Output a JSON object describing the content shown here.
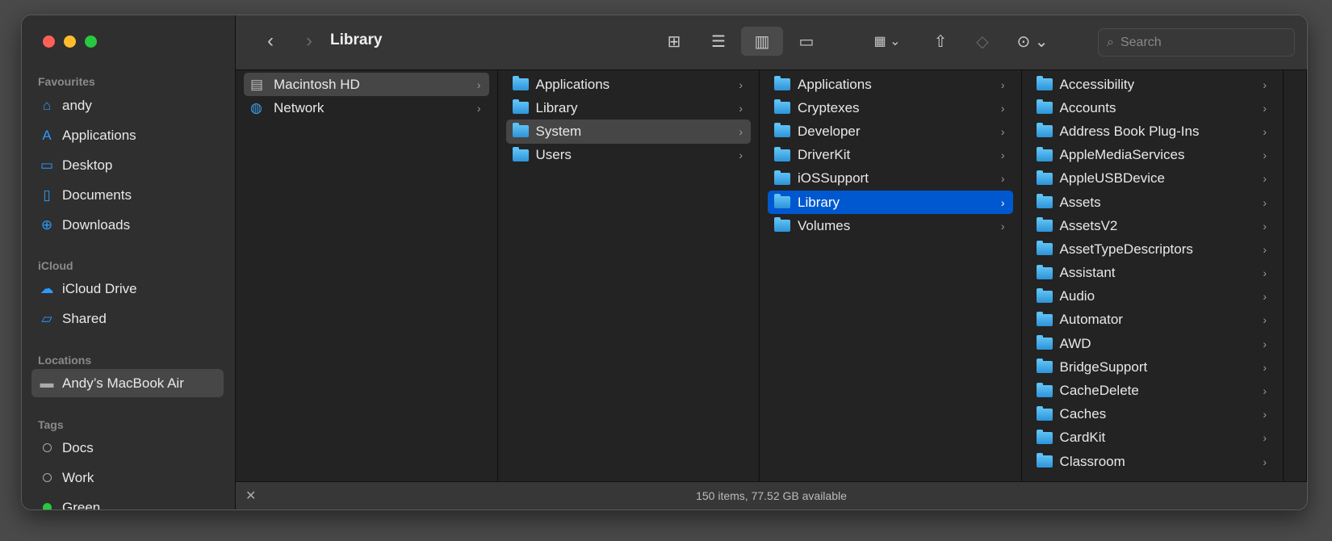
{
  "window": {
    "title": "Library"
  },
  "sidebar": {
    "sections": [
      {
        "label": "Favourites",
        "items": [
          {
            "label": "andy",
            "icon": "house-icon"
          },
          {
            "label": "Applications",
            "icon": "applications-icon"
          },
          {
            "label": "Desktop",
            "icon": "desktop-icon"
          },
          {
            "label": "Documents",
            "icon": "document-icon"
          },
          {
            "label": "Downloads",
            "icon": "download-icon"
          }
        ]
      },
      {
        "label": "iCloud",
        "items": [
          {
            "label": "iCloud Drive",
            "icon": "cloud-icon"
          },
          {
            "label": "Shared",
            "icon": "shared-folder-icon"
          }
        ]
      },
      {
        "label": "Locations",
        "items": [
          {
            "label": "Andy’s MacBook Air",
            "icon": "laptop-icon"
          }
        ]
      },
      {
        "label": "Tags",
        "items": [
          {
            "label": "Docs"
          },
          {
            "label": "Work"
          },
          {
            "label": "Green",
            "color": "#28c840"
          }
        ]
      }
    ]
  },
  "toolbar": {
    "search_placeholder": "Search"
  },
  "columns": [
    [
      "Macintosh HD",
      "Network"
    ],
    [
      "Applications",
      "Library",
      "System",
      "Users"
    ],
    [
      "Applications",
      "Cryptexes",
      "Developer",
      "DriverKit",
      "iOSSupport",
      "Library",
      "Volumes"
    ],
    [
      "Accessibility",
      "Accounts",
      "Address Book Plug-Ins",
      "AppleMediaServices",
      "AppleUSBDevice",
      "Assets",
      "AssetsV2",
      "AssetTypeDescriptors",
      "Assistant",
      "Audio",
      "Automator",
      "AWD",
      "BridgeSupport",
      "CacheDelete",
      "Caches",
      "CardKit",
      "Classroom"
    ]
  ],
  "status": {
    "text": "150 items, 77.52 GB available"
  },
  "colors": {
    "accent": "#0058d0",
    "folder": "#3ba9ec"
  }
}
